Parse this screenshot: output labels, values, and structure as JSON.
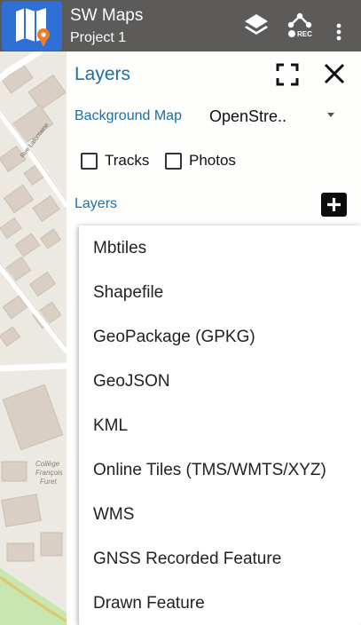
{
  "app": {
    "title": "SW Maps",
    "project": "Project 1",
    "logo_icon": "map-pin-icon",
    "layers_icon": "layers-icon",
    "rec_icon": "record-track-icon",
    "rec_label": "REC",
    "overflow_icon": "overflow-menu-icon"
  },
  "panel": {
    "title": "Layers",
    "fullscreen_icon": "fullscreen-icon",
    "close_icon": "close-icon",
    "background_map_label": "Background Map",
    "background_map_value": "OpenStre..",
    "tracks_label": "Tracks",
    "tracks_checked": false,
    "photos_label": "Photos",
    "photos_checked": false,
    "layers_label": "Layers",
    "add_icon": "plus-icon"
  },
  "menu": {
    "items": [
      "Mbtiles",
      "Shapefile",
      "GeoPackage (GPKG)",
      "GeoJSON",
      "KML",
      "Online Tiles (TMS/WMTS/XYZ)",
      "WMS",
      "GNSS Recorded Feature",
      "Drawn Feature"
    ]
  },
  "map": {
    "labels": [
      "Rue Lafontaine",
      "Collège",
      "François",
      "Furet"
    ]
  },
  "colors": {
    "accent": "#1a6fa8",
    "appbar": "#3c3c3c",
    "logo_bg": "#2f6fd6",
    "pin": "#f07c2a"
  }
}
